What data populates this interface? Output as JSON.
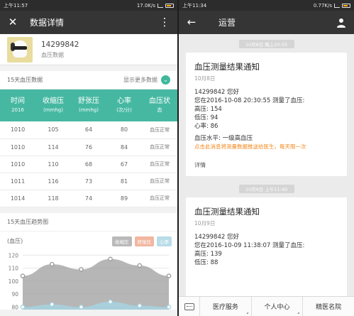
{
  "left": {
    "status": {
      "time": "上午11:57",
      "speed": "17.0K/s"
    },
    "title": "数据详情",
    "profile": {
      "id": "14299842",
      "type": "血压数据"
    },
    "section": {
      "label": "15天血压数据",
      "more": "显示更多数据"
    },
    "table": {
      "headers": [
        {
          "main": "时间",
          "sub": "2016"
        },
        {
          "main": "收缩压",
          "sub": "(mmhg)"
        },
        {
          "main": "舒张压",
          "sub": "(mmhg)"
        },
        {
          "main": "心率",
          "sub": "(次/分)"
        },
        {
          "main": "血压状",
          "sub": "态"
        }
      ],
      "rows": [
        [
          "1010",
          "105",
          "64",
          "80",
          "血压正常"
        ],
        [
          "1010",
          "114",
          "76",
          "84",
          "血压正常"
        ],
        [
          "1010",
          "110",
          "68",
          "67",
          "血压正常"
        ],
        [
          "1011",
          "116",
          "73",
          "81",
          "血压正常"
        ],
        [
          "1014",
          "118",
          "74",
          "89",
          "血压正常"
        ]
      ]
    },
    "trend": {
      "label": "15天血压趋势图",
      "unit": "(血压)"
    },
    "legend": [
      {
        "label": "收缩压",
        "color": "#b9b9b9"
      },
      {
        "label": "舒张压",
        "color": "#f2b6a0"
      },
      {
        "label": "心率",
        "color": "#b9dce8"
      }
    ]
  },
  "chart_data": {
    "type": "area",
    "ylabel": "(血压)",
    "yticks": [
      120,
      110,
      100,
      90,
      80
    ],
    "ylim": [
      78,
      124
    ],
    "x": [
      1,
      2,
      3,
      4,
      5,
      6
    ],
    "series": [
      {
        "name": "收缩压",
        "color": "#9d9d9d",
        "values": [
          104,
          113,
          109,
          117,
          112,
          104
        ]
      },
      {
        "name": "心率",
        "color": "#a7d3e2",
        "values": [
          80,
          82,
          80,
          84,
          81,
          80
        ]
      }
    ]
  },
  "right": {
    "status": {
      "time": "上午11:34",
      "speed": "0.77K/s"
    },
    "title": "运营",
    "cards": [
      {
        "time_pill": "10月8日 晚上20:55",
        "title": "血压测量结果通知",
        "date": "10月8日",
        "greeting": "14299842 您好",
        "measured": "您在2016-10-08 20:30:55 测量了血压:",
        "high": "高压: 154",
        "low": "低压: 94",
        "rate": "心率: 86",
        "level": "血压水平: 一级高血压",
        "notice": "点击此消息将测量数据推送给医生，每天限一次",
        "detail": "详情"
      },
      {
        "time_pill": "10月9日 上午11:40",
        "title": "血压测量结果通知",
        "date": "10月9日",
        "greeting": "14299842 您好",
        "measured": "您在2016-10-09 11:38:07 测量了血压:",
        "high": "高压: 139",
        "low": "低压: 88"
      }
    ],
    "menu": [
      "医疗服务",
      "个人中心",
      "精医名院"
    ]
  }
}
